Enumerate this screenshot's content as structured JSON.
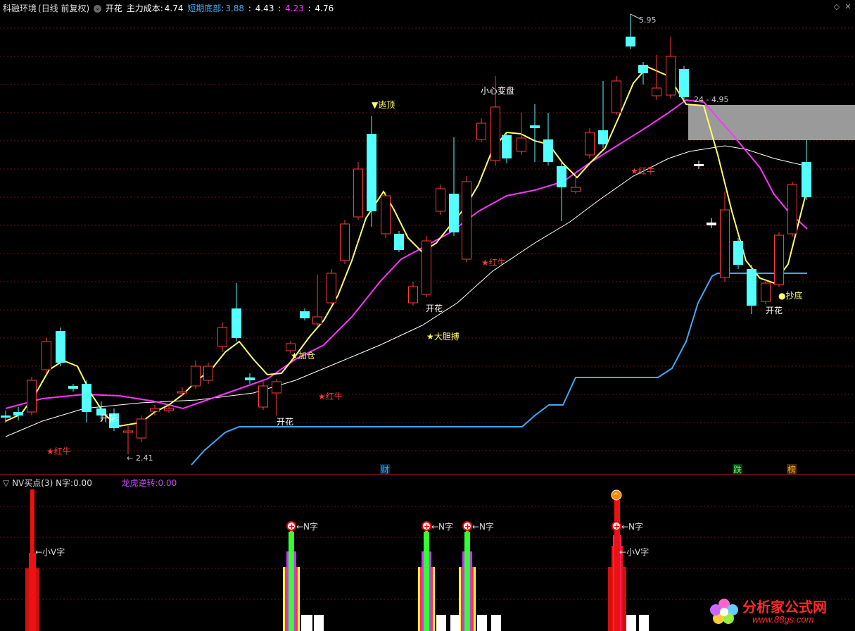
{
  "header": {
    "title": "科融环境",
    "period": "(日线 前复权)",
    "indicator": "开花",
    "cost_label": "主力成本:",
    "cost_value": "4.74",
    "bottom_label": "短期底部:",
    "bottom_v1": "3.88",
    "bottom_v2": "4.43",
    "bottom_v3": "4.23",
    "bottom_v4": "4.76"
  },
  "sub_header": {
    "name": "NV买点(3)",
    "n_label": "N字:",
    "n_value": "0.00",
    "reverse_label": "龙虎逆转:",
    "reverse_value": "0.00"
  },
  "annotations": {
    "high": "5.95",
    "low": "2.41",
    "range": "24 - 4.95",
    "escape": "▼逃顶",
    "caution": "小心变盘",
    "bull1": "★红牛",
    "bull2": "★红牛",
    "bull3": "★红牛",
    "bull4": "★红牛",
    "bloom1": "开花",
    "bloom2": "开花",
    "bloom3": "开花",
    "bloom4": "开花",
    "add_pos": "★加仓",
    "bold": "★大胆搏",
    "buy": "●抄底",
    "cai": "财",
    "die": "跌",
    "bang": "榜",
    "small_v1": "←小V字",
    "small_v2": "←小V字",
    "nzi1": "←N字",
    "nzi2": "←N字",
    "nzi3": "←N字",
    "nzi4": "←N字"
  },
  "colors": {
    "up": "#ff3c3c",
    "down": "#54ffff",
    "ma_short": "#ffff66",
    "ma_mid": "#ff33ff",
    "ma_long": "#ffffff",
    "support": "#3fa9f5",
    "grid": "#7a1010"
  },
  "watermark": {
    "brand": "分析家公式网",
    "url": "www.88gs.com"
  }
}
